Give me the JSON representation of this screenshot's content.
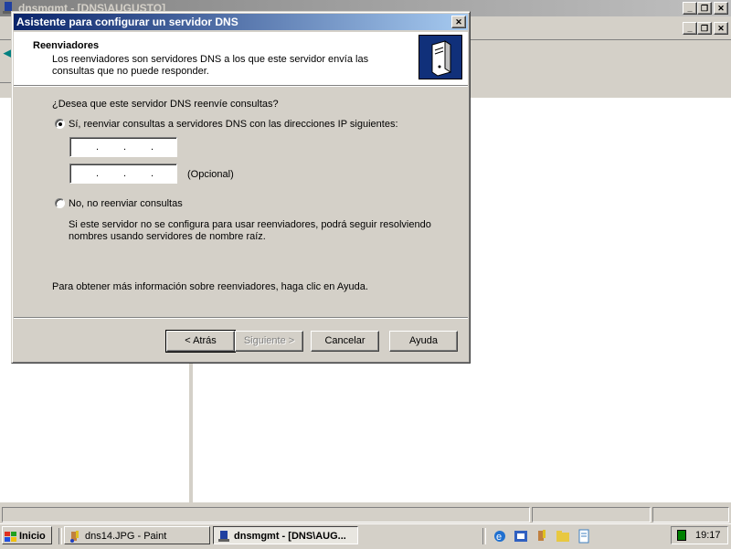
{
  "background_window": {
    "title": "dnsmgmt - [DNS\\AUGUSTO]"
  },
  "dialog": {
    "title": "Asistente para configurar un servidor DNS",
    "banner": {
      "title": "Reenviadores",
      "description": "Los reenviadores son servidores DNS a los que este servidor envía las consultas que no puede responder."
    },
    "question": "¿Desea que este servidor DNS reenvíe consultas?",
    "option_yes": {
      "label": "Sí, reenviar consultas a servidores DNS con las direcciones IP siguientes:",
      "selected": true
    },
    "ip1": {
      "value": ""
    },
    "ip2": {
      "value": "",
      "suffix": "(Opcional)"
    },
    "option_no": {
      "label": "No, no reenviar consultas",
      "selected": false
    },
    "option_no_note": "Si este servidor no se configura para usar reenviadores, podrá seguir resolviendo nombres usando servidores de nombre raíz.",
    "help_text": "Para obtener más información sobre reenviadores, haga clic en Ayuda.",
    "buttons": {
      "back": "< Atrás",
      "next": "Siguiente >",
      "cancel": "Cancelar",
      "help": "Ayuda"
    }
  },
  "taskbar": {
    "start": "Inicio",
    "tasks": [
      {
        "label": "dns14.JPG - Paint",
        "active": false
      },
      {
        "label": "dnsmgmt - [DNS\\AUG...",
        "active": true
      }
    ],
    "clock": "19:17"
  },
  "colors": {
    "title_active_start": "#0a246a",
    "title_active_end": "#a6caf0",
    "face": "#d4d0c8"
  }
}
